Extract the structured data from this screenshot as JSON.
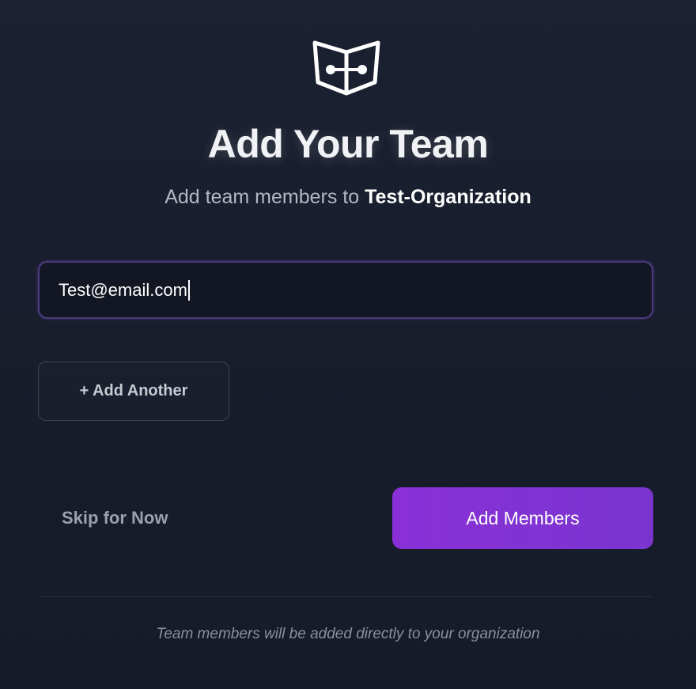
{
  "header": {
    "logo_icon": "book-network-icon",
    "title": "Add Your Team",
    "subtitle_prefix": "Add team members to ",
    "organization_name": "Test-Organization"
  },
  "form": {
    "email_value": "Test@email.com",
    "add_another_label": "+ Add Another"
  },
  "actions": {
    "skip_label": "Skip for Now",
    "submit_label": "Add Members"
  },
  "footer": {
    "note": "Team members will be added directly to your organization"
  },
  "colors": {
    "background": "#181e2d",
    "accent": "#8a30d8",
    "input_border": "#4c3a7a"
  }
}
